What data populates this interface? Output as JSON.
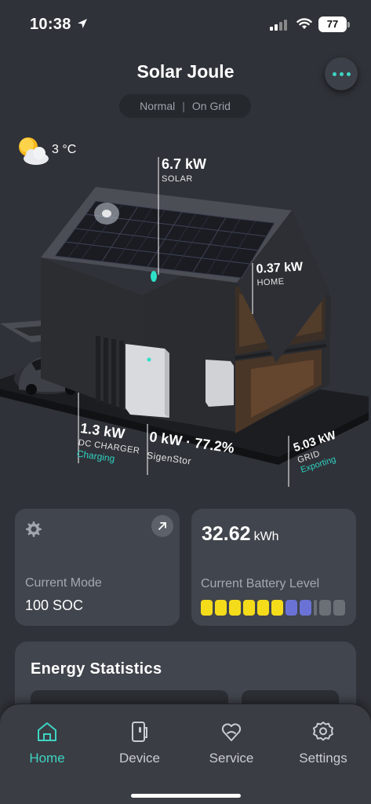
{
  "status_bar": {
    "time": "10:38",
    "battery_percent": "77",
    "icons": [
      "location-arrow-icon",
      "signal-icon",
      "wifi-icon",
      "battery-icon"
    ]
  },
  "header": {
    "title": "Solar Joule",
    "mode": "Normal",
    "separator": "|",
    "grid_state": "On Grid",
    "menu_icon": "more-dots-icon"
  },
  "weather": {
    "temperature": "3 °C",
    "icon": "partly-cloudy-icon"
  },
  "energy_flow": {
    "solar": {
      "value": "6.7 kW",
      "label": "SOLAR"
    },
    "home": {
      "value": "0.37 kW",
      "label": "HOME"
    },
    "dc_charger": {
      "value": "1.3 kW",
      "label": "DC CHARGER",
      "status": "Charging"
    },
    "storage": {
      "value": "0 kW · 77.2%",
      "label": "SigenStor"
    },
    "grid": {
      "value": "5.03 kW",
      "label": "GRID",
      "status": "Exporting"
    }
  },
  "mode_card": {
    "label": "Current Mode",
    "value": "100 SOC",
    "icon": "gear-icon",
    "action_icon": "arrow-up-right-icon"
  },
  "battery_card": {
    "value": "32.62",
    "unit": "kWh",
    "label": "Current Battery Level",
    "segments": [
      "yellow",
      "yellow",
      "yellow",
      "yellow",
      "yellow",
      "yellow",
      "blue",
      "blue",
      "gray",
      "gray",
      "gray"
    ]
  },
  "stats": {
    "title": "Energy Statistics"
  },
  "tabs": [
    {
      "label": "Home",
      "icon": "home-icon",
      "active": true
    },
    {
      "label": "Device",
      "icon": "device-icon",
      "active": false
    },
    {
      "label": "Service",
      "icon": "service-icon",
      "active": false
    },
    {
      "label": "Settings",
      "icon": "settings-icon",
      "active": false
    }
  ],
  "colors": {
    "background": "#2f3238",
    "card": "#41454d",
    "accent": "#3fd4c4",
    "battery_yellow": "#f4dc1b",
    "battery_blue": "#6b72d6",
    "battery_gray": "#6b6f76"
  }
}
